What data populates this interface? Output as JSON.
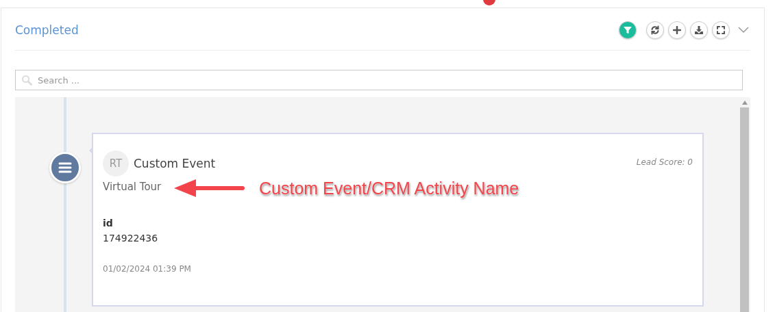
{
  "panel": {
    "title": "Completed",
    "collapsed": false,
    "filter_active": true
  },
  "search": {
    "placeholder": "Search ..."
  },
  "timeline": [
    {
      "avatar": "RT",
      "event_type": "Custom Event",
      "lead_score": "Lead Score: 0",
      "activity_name": "Virtual Tour",
      "fields": [
        {
          "label": "id",
          "value": "174922436"
        }
      ],
      "timestamp": "01/02/2024 01:39 PM"
    }
  ],
  "annotation": {
    "text": "Custom Event/CRM Activity Name"
  }
}
